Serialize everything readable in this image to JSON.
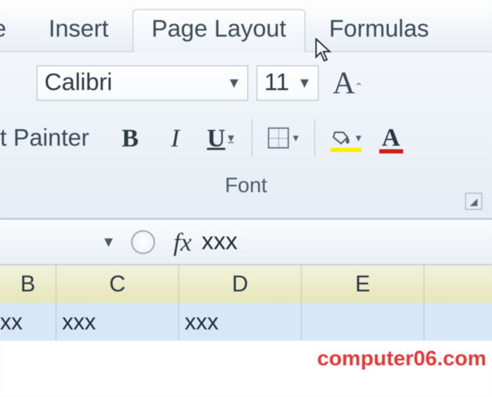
{
  "tabs": {
    "home_fragment": "e",
    "insert": "Insert",
    "page_layout": "Page Layout",
    "formulas": "Formulas"
  },
  "ribbon": {
    "font_name": "Calibri",
    "font_size": "11",
    "painter_fragment": "t Painter",
    "bold_glyph": "B",
    "italic_glyph": "I",
    "underline_glyph": "U",
    "grow_glyph": "A",
    "fontcolor_glyph": "A",
    "group_label": "Font",
    "colors": {
      "fill_highlight": "#ffeb00",
      "font_color": "#d11a1a"
    }
  },
  "formula_bar": {
    "fx_label": "fx",
    "value": "xxx"
  },
  "columns": [
    "B",
    "C",
    "D",
    "E"
  ],
  "row_cells": [
    "xx",
    "xxx",
    "xxx",
    ""
  ],
  "watermark": "computer06.com"
}
